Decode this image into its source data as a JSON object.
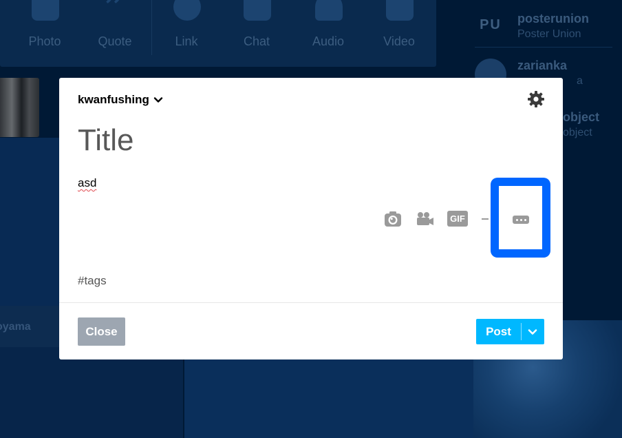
{
  "post_types": [
    {
      "label": "Photo",
      "icon": "camera-icon"
    },
    {
      "label": "Quote",
      "icon": "quote-icon"
    },
    {
      "label": "Link",
      "icon": "link-icon"
    },
    {
      "label": "Chat",
      "icon": "chat-icon"
    },
    {
      "label": "Audio",
      "icon": "headphones-icon"
    },
    {
      "label": "Video",
      "icon": "video-camera-icon"
    }
  ],
  "sidebar": {
    "items": [
      {
        "name": "posterunion",
        "subtitle": "Poster Union",
        "avatar_text": "PU"
      },
      {
        "name": "zarianka",
        "subtitle": "a",
        "avatar_text": ""
      },
      {
        "name": "object",
        "subtitle": "object",
        "avatar_text": ""
      }
    ]
  },
  "background": {
    "name_strip": "oyama"
  },
  "editor": {
    "blog_name": "kwanfushing",
    "title_placeholder": "Title",
    "body_text": "asd",
    "gif_label": "GIF",
    "tags_placeholder": "#tags",
    "close_label": "Close",
    "post_label": "Post"
  },
  "colors": {
    "highlight": "#0066ff",
    "post_button": "#00b8ff",
    "close_button": "#9da6b1",
    "backdrop": "#001935"
  }
}
